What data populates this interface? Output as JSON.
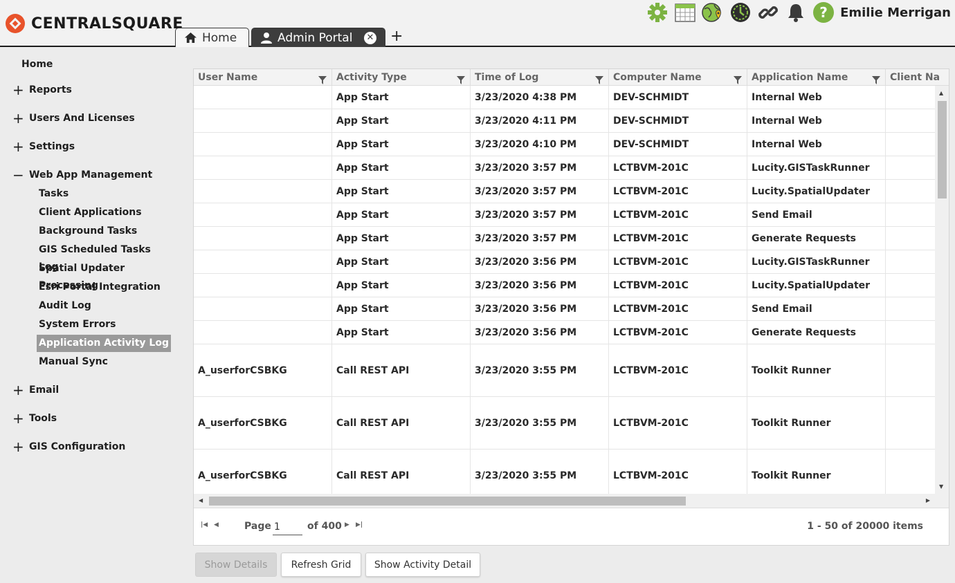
{
  "brand": {
    "name": "CENTRALSQUARE",
    "color": "#e8532b"
  },
  "tabs": [
    {
      "label": "Home",
      "icon": "home-icon"
    },
    {
      "label": "Admin Portal",
      "icon": "user-icon"
    }
  ],
  "tab_add": "+",
  "toolbar": {
    "icons": [
      "gear-icon",
      "calendar-icon",
      "globe-pin-icon",
      "clock-icon",
      "link-icon",
      "bell-icon",
      "help-icon"
    ],
    "user_name": "Emilie Merrigan"
  },
  "sidebar": {
    "home": "Home",
    "groups": [
      {
        "label": "Reports",
        "expanded": false
      },
      {
        "label": "Users And Licenses",
        "expanded": false
      },
      {
        "label": "Settings",
        "expanded": false
      },
      {
        "label": "Web App Management",
        "expanded": true
      },
      {
        "label": "Email",
        "expanded": false
      },
      {
        "label": "Tools",
        "expanded": false
      },
      {
        "label": "GIS Configuration",
        "expanded": false
      }
    ],
    "web_app_items": [
      "Tasks",
      "Client Applications",
      "Background Tasks",
      "GIS Scheduled Tasks Log",
      "Spatial Updater Processing",
      "Esri Portal Integration",
      "Audit Log",
      "System Errors",
      "Application Activity Log",
      "Manual Sync"
    ],
    "active_item": "Application Activity Log"
  },
  "grid": {
    "columns": [
      "User Name",
      "Activity Type",
      "Time of Log",
      "Computer Name",
      "Application Name",
      "Client Na"
    ],
    "rows": [
      [
        "",
        "App Start",
        "3/23/2020 4:38 PM",
        "DEV-SCHMIDT",
        "Internal Web",
        ""
      ],
      [
        "",
        "App Start",
        "3/23/2020 4:11 PM",
        "DEV-SCHMIDT",
        "Internal Web",
        ""
      ],
      [
        "",
        "App Start",
        "3/23/2020 4:10 PM",
        "DEV-SCHMIDT",
        "Internal Web",
        ""
      ],
      [
        "",
        "App Start",
        "3/23/2020 3:57 PM",
        "LCTBVM-201C",
        "Lucity.GISTaskRunner",
        ""
      ],
      [
        "",
        "App Start",
        "3/23/2020 3:57 PM",
        "LCTBVM-201C",
        "Lucity.SpatialUpdater",
        ""
      ],
      [
        "",
        "App Start",
        "3/23/2020 3:57 PM",
        "LCTBVM-201C",
        "Send Email",
        ""
      ],
      [
        "",
        "App Start",
        "3/23/2020 3:57 PM",
        "LCTBVM-201C",
        "Generate Requests",
        ""
      ],
      [
        "",
        "App Start",
        "3/23/2020 3:56 PM",
        "LCTBVM-201C",
        "Lucity.GISTaskRunner",
        ""
      ],
      [
        "",
        "App Start",
        "3/23/2020 3:56 PM",
        "LCTBVM-201C",
        "Lucity.SpatialUpdater",
        ""
      ],
      [
        "",
        "App Start",
        "3/23/2020 3:56 PM",
        "LCTBVM-201C",
        "Send Email",
        ""
      ],
      [
        "",
        "App Start",
        "3/23/2020 3:56 PM",
        "LCTBVM-201C",
        "Generate Requests",
        ""
      ],
      [
        "A_userforCSBKG",
        "Call REST API",
        "3/23/2020 3:55 PM",
        "LCTBVM-201C",
        "Toolkit Runner",
        ""
      ],
      [
        "A_userforCSBKG",
        "Call REST API",
        "3/23/2020 3:55 PM",
        "LCTBVM-201C",
        "Toolkit Runner",
        ""
      ],
      [
        "A_userforCSBKG",
        "Call REST API",
        "3/23/2020 3:55 PM",
        "LCTBVM-201C",
        "Toolkit Runner",
        ""
      ]
    ]
  },
  "pager": {
    "page_label": "Page",
    "page_value": "1",
    "of_label": "of 400",
    "items_label": "1 - 50 of 20000 items"
  },
  "buttons": {
    "show_details": "Show Details",
    "refresh_grid": "Refresh Grid",
    "show_activity_detail": "Show Activity Detail"
  }
}
